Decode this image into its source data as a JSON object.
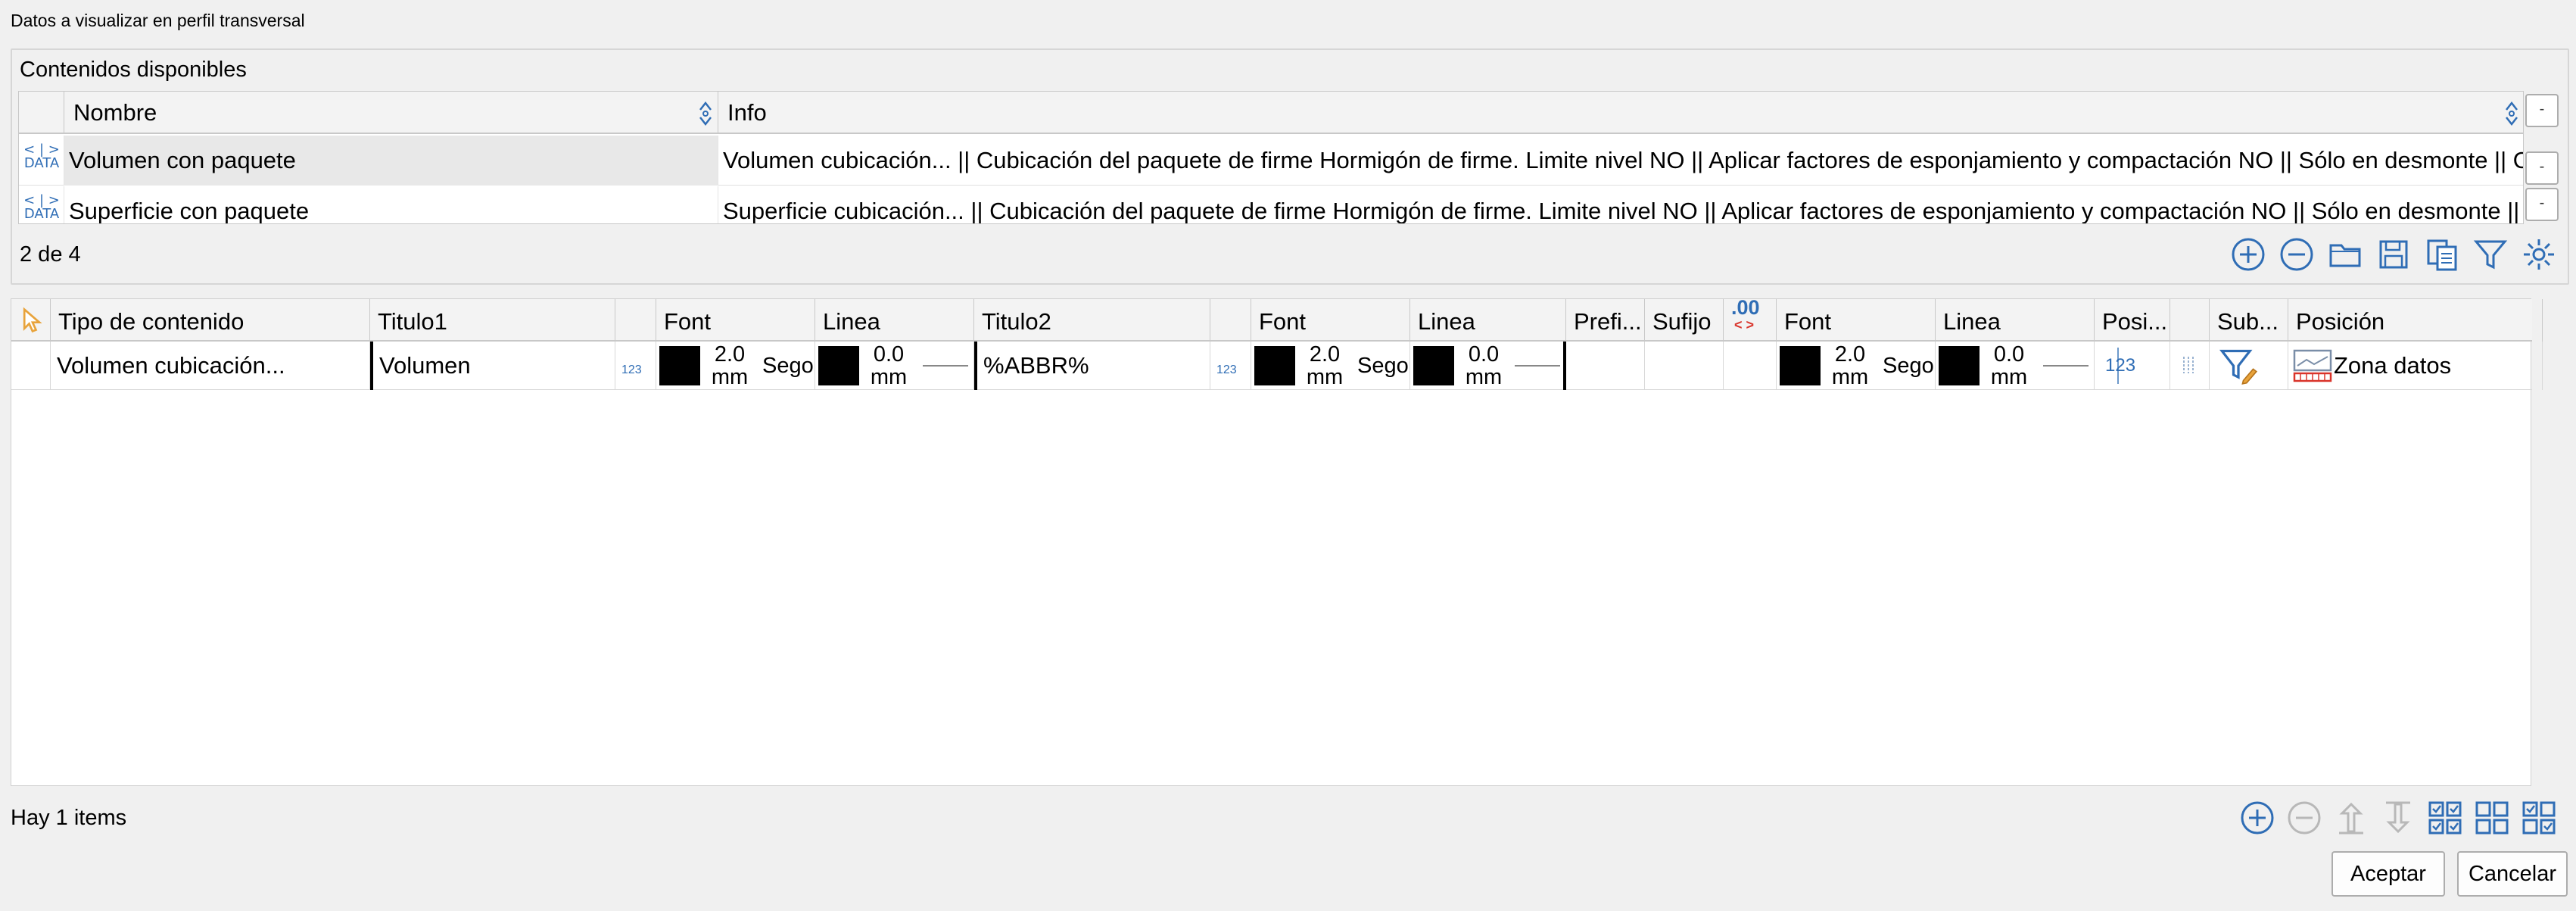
{
  "window": {
    "title": "Datos a visualizar en perfil transversal"
  },
  "available": {
    "group_title": "Contenidos disponibles",
    "columns": {
      "nombre": "Nombre",
      "info": "Info"
    },
    "icon_label": "DATA",
    "rows": [
      {
        "nombre": "Volumen con paquete",
        "info": "Volumen cubicación... || Cubicación del paquete de firme Hormigón de firme. Limite nivel NO || Aplicar factores de esponjamiento y compactación NO || Sólo en desmonte || Omit..."
      },
      {
        "nombre": "Superficie con paquete",
        "info": "Superficie cubicación... || Cubicación del paquete de firme Hormigón de firme. Limite nivel NO || Aplicar factores de esponjamiento y compactación NO || Sólo en desmonte || Omit..."
      }
    ],
    "count": "2 de 4"
  },
  "selected": {
    "columns": {
      "tipo": "Tipo de contenido",
      "titulo1": "Titulo1",
      "font1": "Font",
      "linea1": "Linea",
      "titulo2": "Titulo2",
      "font2": "Font",
      "linea2": "Linea",
      "prefijo": "Prefi...",
      "sufijo": "Sufijo",
      "decimals": ".00",
      "font3": "Font",
      "linea3": "Linea",
      "posi": "Posi...",
      "sub": "Sub...",
      "posicion": "Posición"
    },
    "row": {
      "tipo": "Volumen cubicación...",
      "titulo1": "Volumen",
      "fmt1": "123",
      "font1_size": "2.0",
      "font1_unit": "mm",
      "font1_name": "Sego",
      "linea1_size": "0.0",
      "linea1_unit": "mm",
      "titulo2": "%ABBR%",
      "fmt2": "123",
      "font2_size": "2.0",
      "font2_unit": "mm",
      "font2_name": "Sego",
      "linea2_size": "0.0",
      "linea2_unit": "mm",
      "font3_size": "2.0",
      "font3_unit": "mm",
      "font3_name": "Sego",
      "linea3_size": "0.0",
      "linea3_unit": "mm",
      "posi": "123",
      "posicion": "Zona datos"
    },
    "items_count": "Hay 1 items"
  },
  "buttons": {
    "accept": "Aceptar",
    "cancel": "Cancelar"
  },
  "colors": {
    "accent": "#2f6db5",
    "icon_orange": "#e8a33b",
    "icon_red": "#d9342b"
  }
}
